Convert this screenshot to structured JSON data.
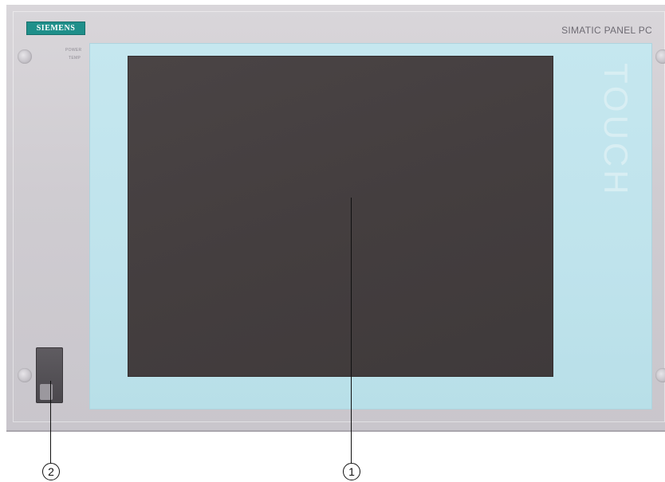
{
  "panel": {
    "brand": "SIEMENS",
    "model": "SIMATIC PANEL PC",
    "touch_label": "TOUCH",
    "led_labels": [
      "POWER",
      "TEMP"
    ],
    "colors": {
      "housing": "#cfccd1",
      "glass": "#c5e7ef",
      "display": "#444041",
      "brand_badge": "#1f8f8a"
    }
  },
  "callouts": [
    {
      "number": "1",
      "target": "touch-screen-display"
    },
    {
      "number": "2",
      "target": "usb-port-cover"
    }
  ]
}
